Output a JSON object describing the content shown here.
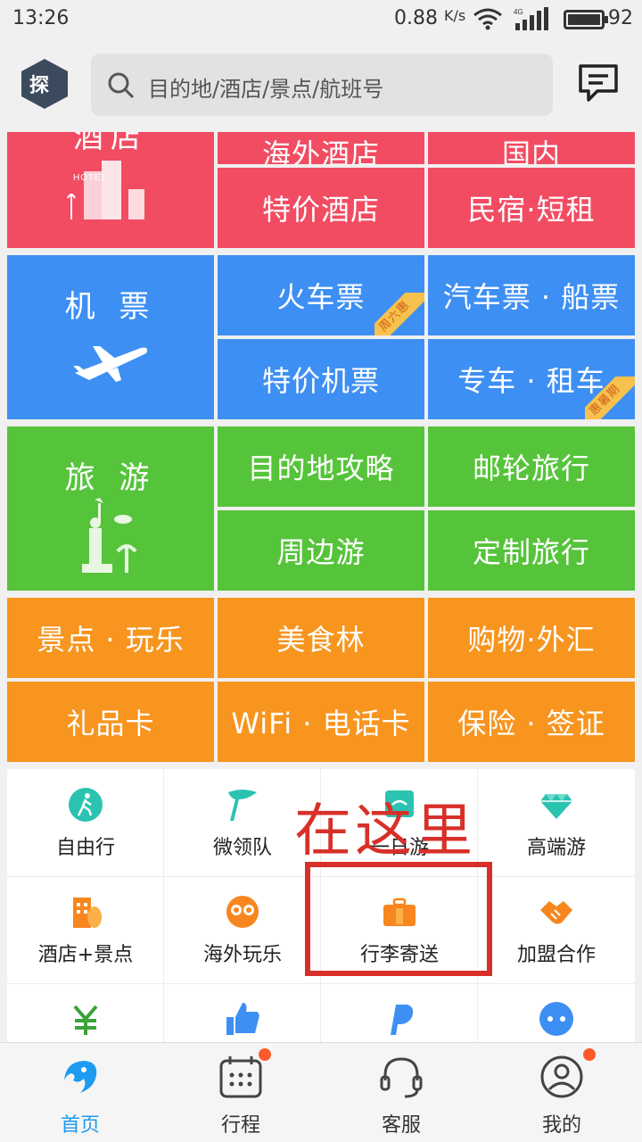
{
  "status_bar": {
    "time": "13:26",
    "speed": "0.88",
    "speed_unit": "K/s",
    "battery": "92"
  },
  "search": {
    "placeholder": "目的地/酒店/景点/航班号"
  },
  "tiles": {
    "hotel_main": "酒店",
    "overseas_hotel": "海外酒店",
    "inn": "国内",
    "special_hotel": "特价酒店",
    "homestay": "民宿·短租",
    "flight_main": "机 票",
    "train": "火车票",
    "train_badge": "周六惠",
    "bus_ship": "汽车票 · 船票",
    "special_flight": "特价机票",
    "car_rental": "专车 · 租车",
    "car_badge": "惠暑期",
    "travel_main": "旅 游",
    "guide": "目的地攻略",
    "cruise": "邮轮旅行",
    "nearby": "周边游",
    "custom": "定制旅行",
    "attractions": "景点 · 玩乐",
    "food": "美食林",
    "shopping": "购物·外汇",
    "giftcard": "礼品卡",
    "wifi": "WiFi · 电话卡",
    "insurance": "保险 · 签证"
  },
  "icon_grid": [
    {
      "label": "自由行",
      "icon": "walker-icon"
    },
    {
      "label": "微领队",
      "icon": "flag-icon"
    },
    {
      "label": "一日游",
      "icon": "calendar-icon"
    },
    {
      "label": "高端游",
      "icon": "diamond-icon"
    },
    {
      "label": "酒店+景点",
      "icon": "hotel-icon"
    },
    {
      "label": "海外玩乐",
      "icon": "sunglasses-icon"
    },
    {
      "label": "行李寄送",
      "icon": "luggage-icon"
    },
    {
      "label": "加盟合作",
      "icon": "handshake-icon"
    },
    {
      "label": "",
      "icon": "yuan-icon"
    },
    {
      "label": "",
      "icon": "thumbs-up-icon"
    },
    {
      "label": "",
      "icon": "paypal-icon"
    },
    {
      "label": "",
      "icon": "more-icon"
    }
  ],
  "annotation": {
    "text": "在这里"
  },
  "bottom_nav": [
    {
      "label": "首页",
      "icon": "dolphin-icon",
      "active": true
    },
    {
      "label": "行程",
      "icon": "calendar-grid-icon",
      "active": false
    },
    {
      "label": "客服",
      "icon": "headset-icon",
      "active": false
    },
    {
      "label": "我的",
      "icon": "user-icon",
      "active": false
    }
  ],
  "colors": {
    "red": "#f24c63",
    "blue": "#3e8ff3",
    "green": "#56c43b",
    "orange": "#f7951f",
    "annotation": "#d83028"
  }
}
